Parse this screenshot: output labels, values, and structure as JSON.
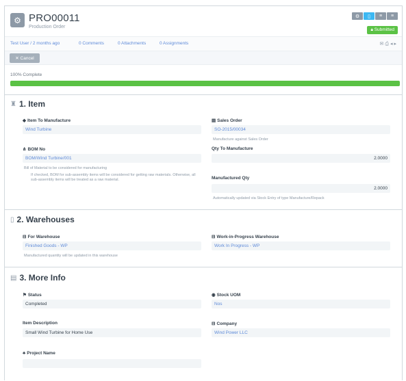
{
  "header": {
    "doc_icon": "gear-icon",
    "title": "PRO00011",
    "subtitle": "Production Order",
    "buttons": [
      "gears-icon",
      "print-icon",
      "list-icon",
      "menu-icon"
    ],
    "status": "Submitted",
    "status_color": "#5bc245"
  },
  "links": {
    "user": "Test User / 2 months ago",
    "comments": "0 Comments",
    "attachments": "0 Attachments",
    "assignments": "0 Assignments"
  },
  "toolbar": {
    "cancel_label": "Cancel"
  },
  "progress": {
    "label": "100% Complete",
    "percent": 100,
    "color": "#5bc245"
  },
  "sections": {
    "item": {
      "title": "1. Item",
      "item_to_manufacture_label": "Item To Manufacture",
      "item_to_manufacture_value": "Wind Turbine",
      "sales_order_label": "Sales Order",
      "sales_order_value": "SO-2015/00034",
      "sales_order_help": "Manufacture against Sales Order",
      "bom_no_label": "BOM No",
      "bom_no_value": "BOM/Wind Turbine/001",
      "bom_help": "Bill of Material to be considered for manufacturing",
      "bom_help2": "If checked, BOM for sub-assembly items will be considered for getting raw materials. Otherwise, all sub-assembly items will be treated as a raw material.",
      "qty_label": "Qty To Manufacture",
      "qty_value": "2.0000",
      "manufactured_qty_label": "Manufactured Qty",
      "manufactured_qty_value": "2.0000",
      "manufactured_qty_help": "Automatically updated via Stock Entry of type Manufacture/Repack"
    },
    "warehouses": {
      "title": "2. Warehouses",
      "for_warehouse_label": "For Warehouse",
      "for_warehouse_value": "Finished Goods - WP",
      "for_warehouse_help": "Manufactured quantity will be updated in this warehouse",
      "wip_label": "Work-in-Progress Warehouse",
      "wip_value": "Work In Progress - WP"
    },
    "more_info": {
      "title": "3. More Info",
      "status_label": "Status",
      "status_value": "Completed",
      "stock_uom_label": "Stock UOM",
      "stock_uom_value": "Nos",
      "item_desc_label": "Item Description",
      "item_desc_value": "Small Wind Turbine for Home Use",
      "company_label": "Company",
      "company_value": "Wind Power LLC",
      "project_label": "Project Name",
      "project_value": ""
    }
  }
}
